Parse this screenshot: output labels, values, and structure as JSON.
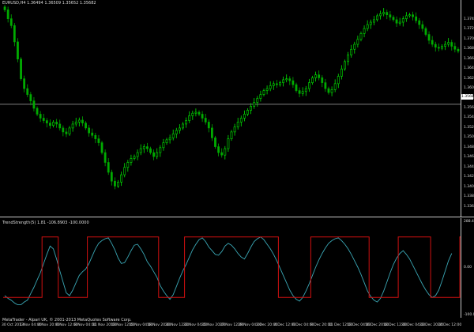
{
  "chart": {
    "symbol_line": "EURUSD,H4  1.36494 1.36509 1.35652 1.35682",
    "indicator_line": "TrendStrength(5) 1.81 -106.8903 -100.0000",
    "copyright": "MetaTrader - Alpari UK, © 2001-2013 MetaQuotes Software Corp.",
    "current_price_tag": "1.3568",
    "price_labels": [
      "1.3740",
      "1.3720",
      "1.3700",
      "1.3680",
      "1.3660",
      "1.3640",
      "1.3620",
      "1.3600",
      "1.3580",
      "1.3560",
      "1.3540",
      "1.3520",
      "1.3500",
      "1.3480",
      "1.3460",
      "1.3440",
      "1.3420",
      "1.3400",
      "1.3380",
      "1.3360"
    ],
    "indicator_labels": [
      "288.4987",
      "0.00",
      "-100.0000"
    ],
    "time_labels": [
      "30 Oct 2013",
      "1 Nov 04:00",
      "4 Nov 20:00",
      "6 Nov 12:00",
      "8 Nov 04:00",
      "11 Nov 20:00",
      "13 Nov 12:00",
      "15 Nov 04:00",
      "18 Nov 20:00",
      "20 Nov 12:00",
      "22 Nov 04:00",
      "25 Nov 20:00",
      "27 Nov 12:00",
      "29 Nov 04:00",
      "2 Dec 20:00",
      "4 Dec 12:00",
      "6 Dec 04:00",
      "9 Dec 20:00",
      "11 Dec 12:00",
      "13 Dec 04:00",
      "16 Dec 20:00",
      "18 Dec 12:00",
      "20 Dec 04:00",
      "23 Dec 20:00",
      "24 Dec 12:00"
    ]
  },
  "colors": {
    "bull": "#00e600",
    "bear": "#00aa00",
    "osc": "#3aa7b5",
    "trend": "#d01010",
    "grid": "#c8c8c8"
  },
  "series": {
    "closes": [
      1.376,
      1.3742,
      1.3728,
      1.3695,
      1.366,
      1.362,
      1.36,
      1.3588,
      1.3575,
      1.356,
      1.3548,
      1.354,
      1.3535,
      1.353,
      1.3525,
      1.3532,
      1.3528,
      1.352,
      1.3512,
      1.3508,
      1.352,
      1.3528,
      1.3532,
      1.3536,
      1.353,
      1.352,
      1.351,
      1.3505,
      1.3498,
      1.349,
      1.347,
      1.345,
      1.343,
      1.3412,
      1.3402,
      1.341,
      1.3425,
      1.344,
      1.345,
      1.3458,
      1.3462,
      1.347,
      1.3478,
      1.3482,
      1.3478,
      1.347,
      1.3462,
      1.347,
      1.348,
      1.349,
      1.3496,
      1.35,
      1.3508,
      1.3515,
      1.352,
      1.3528,
      1.3535,
      1.3545,
      1.355,
      1.3552,
      1.3548,
      1.354,
      1.3532,
      1.352,
      1.35,
      1.3482,
      1.347,
      1.3465,
      1.3478,
      1.3498,
      1.3512,
      1.3522,
      1.3532,
      1.354,
      1.3548,
      1.3556,
      1.3564,
      1.3572,
      1.358,
      1.3588,
      1.3596,
      1.36,
      1.3606,
      1.361,
      1.3608,
      1.3612,
      1.3618,
      1.362,
      1.3616,
      1.3608,
      1.3596,
      1.359,
      1.3594,
      1.36,
      1.3612,
      1.3622,
      1.3628,
      1.3622,
      1.3612,
      1.36,
      1.3592,
      1.3598,
      1.361,
      1.3625,
      1.364,
      1.3655,
      1.3668,
      1.368,
      1.369,
      1.37,
      1.3712,
      1.3722,
      1.373,
      1.3735,
      1.374,
      1.3748,
      1.3752,
      1.3755,
      1.375,
      1.3745,
      1.374,
      1.3733,
      1.3735,
      1.3742,
      1.3748,
      1.375,
      1.3746,
      1.3738,
      1.373,
      1.3722,
      1.371,
      1.3698,
      1.369,
      1.3684,
      1.3682,
      1.3686,
      1.369,
      1.3694,
      1.3686,
      1.368,
      1.3676
    ],
    "osc": [
      -62,
      -68,
      -72,
      -78,
      -82,
      -82,
      -76,
      -72,
      -58,
      -44,
      -28,
      -12,
      8,
      28,
      46,
      40,
      18,
      -8,
      -32,
      -56,
      -62,
      -50,
      -34,
      -18,
      -10,
      -4,
      8,
      24,
      40,
      52,
      58,
      62,
      64,
      52,
      38,
      20,
      8,
      10,
      22,
      36,
      48,
      50,
      40,
      28,
      12,
      2,
      -10,
      -22,
      -40,
      -52,
      -62,
      -70,
      -60,
      -42,
      -24,
      -8,
      6,
      22,
      38,
      50,
      60,
      64,
      56,
      44,
      36,
      28,
      26,
      34,
      46,
      52,
      48,
      40,
      30,
      22,
      18,
      30,
      44,
      56,
      62,
      66,
      60,
      50,
      40,
      28,
      14,
      -2,
      -18,
      -34,
      -50,
      -62,
      -70,
      -74,
      -66,
      -52,
      -36,
      -18,
      0,
      16,
      30,
      42,
      52,
      58,
      62,
      64,
      58,
      50,
      40,
      28,
      14,
      0,
      -16,
      -34,
      -52,
      -64,
      -72,
      -76,
      -68,
      -52,
      -32,
      -12,
      6,
      20,
      30,
      36,
      28,
      18,
      4,
      -10,
      -24,
      -38,
      -50,
      -60,
      -66,
      -62,
      -50,
      -30,
      -8,
      14,
      30
    ],
    "trend": [
      -1,
      -1,
      -1,
      -1,
      -1,
      -1,
      -1,
      -1,
      -1,
      -1,
      -1,
      -1,
      1,
      1,
      1,
      1,
      1,
      -1,
      -1,
      -1,
      -1,
      -1,
      -1,
      -1,
      -1,
      -1,
      1,
      1,
      1,
      1,
      1,
      1,
      1,
      1,
      1,
      1,
      1,
      1,
      1,
      1,
      1,
      1,
      1,
      1,
      1,
      1,
      1,
      1,
      -1,
      -1,
      -1,
      -1,
      -1,
      -1,
      -1,
      -1,
      1,
      1,
      1,
      1,
      1,
      1,
      1,
      1,
      1,
      1,
      1,
      1,
      1,
      1,
      1,
      1,
      1,
      1,
      1,
      1,
      1,
      1,
      1,
      1,
      1,
      1,
      1,
      1,
      1,
      -1,
      -1,
      -1,
      -1,
      -1,
      -1,
      -1,
      -1,
      -1,
      -1,
      1,
      1,
      1,
      1,
      1,
      1,
      1,
      1,
      1,
      1,
      1,
      1,
      1,
      1,
      1,
      1,
      1,
      1,
      -1,
      -1,
      -1,
      -1,
      -1,
      -1,
      -1,
      -1,
      -1,
      1,
      1,
      1,
      1,
      1,
      1,
      1,
      1,
      1,
      1,
      -1,
      -1,
      -1,
      -1,
      -1,
      -1,
      -1,
      -1,
      -1,
      1,
      1,
      1
    ]
  }
}
